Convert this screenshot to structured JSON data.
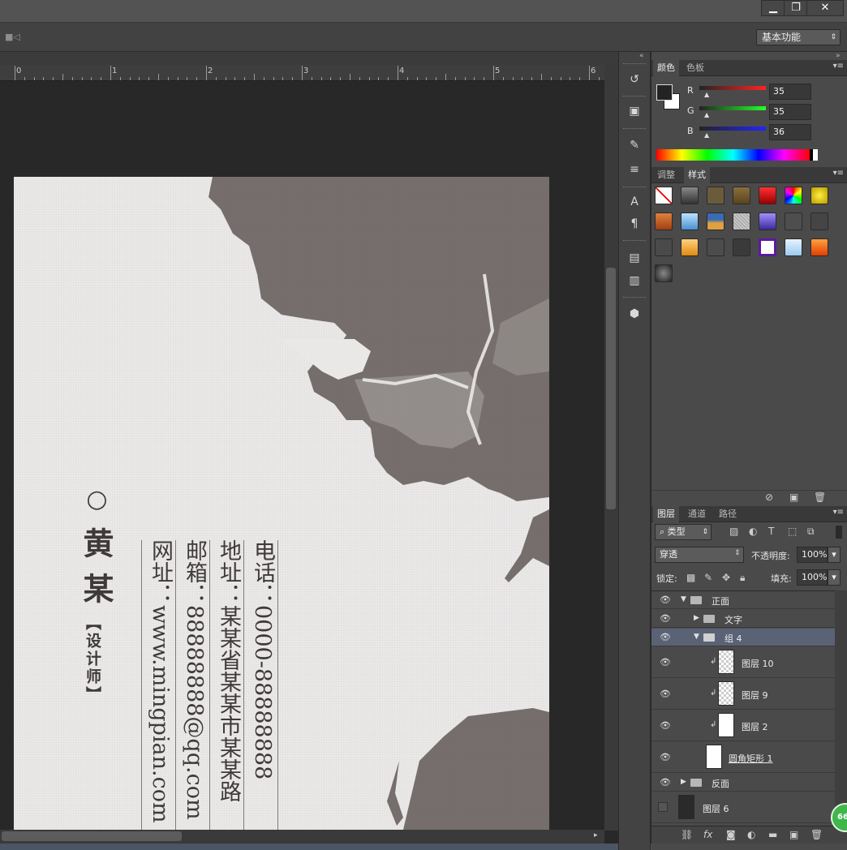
{
  "window": {
    "minimize": "▁",
    "restore": "❐",
    "close": "✕"
  },
  "options_bar": {
    "workspace": "基本功能"
  },
  "ruler": {
    "labels": [
      "0",
      "1",
      "2",
      "3",
      "4",
      "5",
      "6"
    ]
  },
  "card": {
    "name_mark": "○",
    "name_line1": "黄",
    "name_line2": "某",
    "role": "【设计师】",
    "phone": "电话：0000-88888888",
    "address": "地址：某某省某某市某某路",
    "email": "邮箱：88888888@qq.com",
    "website": "网址：www.mingpian.com"
  },
  "tools": [
    "history-icon",
    "3d-icon",
    "brush-settings-icon",
    "adjust-icon",
    "character-icon",
    "paragraph-icon",
    "notes-icon",
    "info-icon",
    "cube-icon"
  ],
  "color_panel": {
    "tabs": [
      "颜色",
      "色板"
    ],
    "r_label": "R",
    "g_label": "G",
    "b_label": "B",
    "r": "35",
    "g": "35",
    "b": "36",
    "fg_color": "#232324"
  },
  "styles_panel": {
    "tabs": [
      "调整",
      "样式"
    ]
  },
  "layers_panel": {
    "tabs": [
      "图层",
      "通道",
      "路径"
    ],
    "filter_kind": "类型",
    "blend_mode": "穿透",
    "opacity_label": "不透明度:",
    "opacity": "100%",
    "lock_label": "锁定:",
    "fill_label": "填充:",
    "fill": "100%",
    "layers": [
      {
        "name": "正面",
        "type": "group-open"
      },
      {
        "name": "文字",
        "type": "group-closed"
      },
      {
        "name": "组 4",
        "type": "group-open",
        "selected": true
      },
      {
        "name": "图层 10",
        "type": "layer"
      },
      {
        "name": "图层 9",
        "type": "layer"
      },
      {
        "name": "图层 2",
        "type": "layer"
      },
      {
        "name": "圆角矩形 1",
        "type": "shape"
      },
      {
        "name": "反面",
        "type": "group-closed"
      },
      {
        "name": "图层 6",
        "type": "layer"
      }
    ]
  },
  "badge": "66"
}
